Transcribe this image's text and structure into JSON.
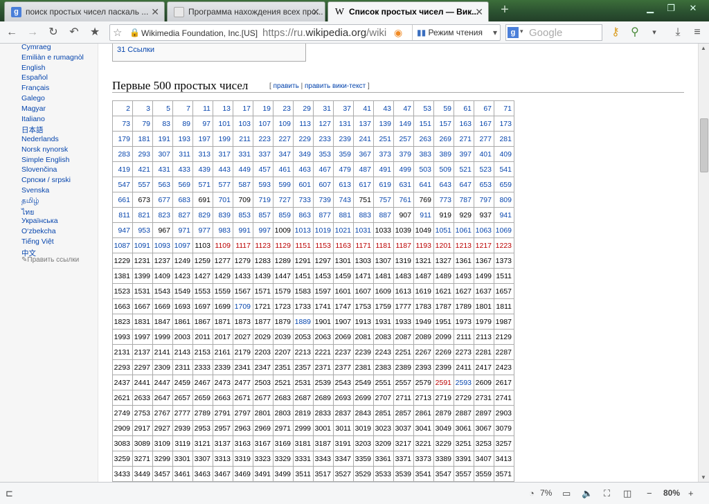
{
  "tabs": [
    {
      "label": "поиск простых чисел паскаль ...",
      "icon": "google-favicon-icon"
    },
    {
      "label": "Программа нахождения всех про...",
      "icon": "page-favicon-icon"
    },
    {
      "label": "Список простых чисел — Вик...",
      "icon": "wikipedia-favicon-icon"
    }
  ],
  "toolbar": {
    "identity": "Wikimedia Foundation, Inc.[US]",
    "url_prefix": "https://ru.",
    "url_domain": "wikipedia.org",
    "url_rest": "/wiki",
    "reader_mode": "Режим чтения",
    "search_placeholder": "Google"
  },
  "sidebar": {
    "languages": [
      "Cymraeg",
      "Emiliàn e rumagnòl",
      "English",
      "Español",
      "Français",
      "Galego",
      "Magyar",
      "Italiano",
      "日本語",
      "Nederlands",
      "Norsk nynorsk",
      "Simple English",
      "Slovenčina",
      "Српски / srpski",
      "Svenska",
      "தமிழ்",
      "ไทย",
      "Українська",
      "O‘zbekcha",
      "Tiếng Việt",
      "中文"
    ],
    "edit_links": "Править ссылки"
  },
  "article": {
    "toc_item": "31 Ссылки",
    "heading": "Первые 500 простых чисел",
    "edit_open": "[",
    "edit": "править",
    "edit_sep": "|",
    "edit_source": "править вики-текст",
    "edit_close": "]"
  },
  "primes_table": [
    [
      2,
      3,
      5,
      7,
      11,
      13,
      17,
      19,
      23,
      29,
      31,
      37,
      41,
      43,
      47,
      53,
      59,
      61,
      67,
      71
    ],
    [
      73,
      79,
      83,
      89,
      97,
      101,
      103,
      107,
      109,
      113,
      127,
      131,
      137,
      139,
      149,
      151,
      157,
      163,
      167,
      173
    ],
    [
      179,
      181,
      191,
      193,
      197,
      199,
      211,
      223,
      227,
      229,
      233,
      239,
      241,
      251,
      257,
      263,
      269,
      271,
      277,
      281
    ],
    [
      283,
      293,
      307,
      311,
      313,
      317,
      331,
      337,
      347,
      349,
      353,
      359,
      367,
      373,
      379,
      383,
      389,
      397,
      401,
      409
    ],
    [
      419,
      421,
      431,
      433,
      439,
      443,
      449,
      457,
      461,
      463,
      467,
      479,
      487,
      491,
      499,
      503,
      509,
      521,
      523,
      541
    ],
    [
      547,
      557,
      563,
      569,
      571,
      577,
      587,
      593,
      599,
      601,
      607,
      613,
      617,
      619,
      631,
      641,
      643,
      647,
      653,
      659
    ],
    [
      661,
      673,
      677,
      683,
      691,
      701,
      709,
      719,
      727,
      733,
      739,
      743,
      751,
      757,
      761,
      769,
      773,
      787,
      797,
      809
    ],
    [
      811,
      821,
      823,
      827,
      829,
      839,
      853,
      857,
      859,
      863,
      877,
      881,
      883,
      887,
      907,
      911,
      919,
      929,
      937,
      941
    ],
    [
      947,
      953,
      967,
      971,
      977,
      983,
      991,
      997,
      1009,
      1013,
      1019,
      1021,
      1031,
      1033,
      1039,
      1049,
      1051,
      1061,
      1063,
      1069
    ],
    [
      1087,
      1091,
      1093,
      1097,
      1103,
      1109,
      1117,
      1123,
      1129,
      1151,
      1153,
      1163,
      1171,
      1181,
      1187,
      1193,
      1201,
      1213,
      1217,
      1223
    ],
    [
      1229,
      1231,
      1237,
      1249,
      1259,
      1277,
      1279,
      1283,
      1289,
      1291,
      1297,
      1301,
      1303,
      1307,
      1319,
      1321,
      1327,
      1361,
      1367,
      1373
    ],
    [
      1381,
      1399,
      1409,
      1423,
      1427,
      1429,
      1433,
      1439,
      1447,
      1451,
      1453,
      1459,
      1471,
      1481,
      1483,
      1487,
      1489,
      1493,
      1499,
      1511
    ],
    [
      1523,
      1531,
      1543,
      1549,
      1553,
      1559,
      1567,
      1571,
      1579,
      1583,
      1597,
      1601,
      1607,
      1609,
      1613,
      1619,
      1621,
      1627,
      1637,
      1657
    ],
    [
      1663,
      1667,
      1669,
      1693,
      1697,
      1699,
      1709,
      1721,
      1723,
      1733,
      1741,
      1747,
      1753,
      1759,
      1777,
      1783,
      1787,
      1789,
      1801,
      1811
    ],
    [
      1823,
      1831,
      1847,
      1861,
      1867,
      1871,
      1873,
      1877,
      1879,
      1889,
      1901,
      1907,
      1913,
      1931,
      1933,
      1949,
      1951,
      1973,
      1979,
      1987
    ],
    [
      1993,
      1997,
      1999,
      2003,
      2011,
      2017,
      2027,
      2029,
      2039,
      2053,
      2063,
      2069,
      2081,
      2083,
      2087,
      2089,
      2099,
      2111,
      2113,
      2129
    ],
    [
      2131,
      2137,
      2141,
      2143,
      2153,
      2161,
      2179,
      2203,
      2207,
      2213,
      2221,
      2237,
      2239,
      2243,
      2251,
      2267,
      2269,
      2273,
      2281,
      2287
    ],
    [
      2293,
      2297,
      2309,
      2311,
      2333,
      2339,
      2341,
      2347,
      2351,
      2357,
      2371,
      2377,
      2381,
      2383,
      2389,
      2393,
      2399,
      2411,
      2417,
      2423
    ],
    [
      2437,
      2441,
      2447,
      2459,
      2467,
      2473,
      2477,
      2503,
      2521,
      2531,
      2539,
      2543,
      2549,
      2551,
      2557,
      2579,
      2591,
      2593,
      2609,
      2617
    ],
    [
      2621,
      2633,
      2647,
      2657,
      2659,
      2663,
      2671,
      2677,
      2683,
      2687,
      2689,
      2693,
      2699,
      2707,
      2711,
      2713,
      2719,
      2729,
      2731,
      2741
    ],
    [
      2749,
      2753,
      2767,
      2777,
      2789,
      2791,
      2797,
      2801,
      2803,
      2819,
      2833,
      2837,
      2843,
      2851,
      2857,
      2861,
      2879,
      2887,
      2897,
      2903
    ],
    [
      2909,
      2917,
      2927,
      2939,
      2953,
      2957,
      2963,
      2969,
      2971,
      2999,
      3001,
      3011,
      3019,
      3023,
      3037,
      3041,
      3049,
      3061,
      3067,
      3079
    ],
    [
      3083,
      3089,
      3109,
      3119,
      3121,
      3137,
      3163,
      3167,
      3169,
      3181,
      3187,
      3191,
      3203,
      3209,
      3217,
      3221,
      3229,
      3251,
      3253,
      3257
    ],
    [
      3259,
      3271,
      3299,
      3301,
      3307,
      3313,
      3319,
      3323,
      3329,
      3331,
      3343,
      3347,
      3359,
      3361,
      3371,
      3373,
      3389,
      3391,
      3407,
      3413
    ],
    [
      3433,
      3449,
      3457,
      3461,
      3463,
      3467,
      3469,
      3491,
      3499,
      3511,
      3517,
      3527,
      3529,
      3533,
      3539,
      3541,
      3547,
      3557,
      3559,
      3571
    ]
  ],
  "colors": {
    "link": "#0645ad",
    "red_link": "#ba0000"
  },
  "status": {
    "traffic": "7%",
    "zoom": "80%"
  }
}
